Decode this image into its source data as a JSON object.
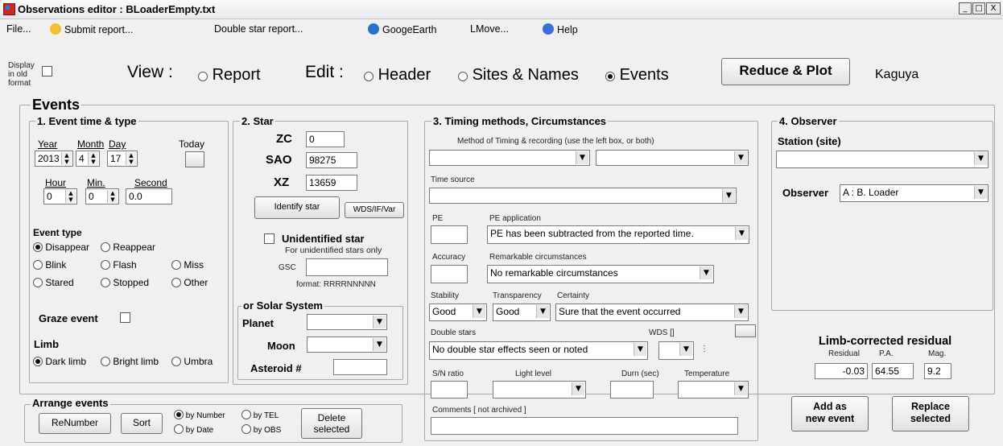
{
  "window": {
    "title": "Observations editor : BLoaderEmpty.txt",
    "btn_min": "_",
    "btn_max": "□",
    "btn_close": "X"
  },
  "menu": {
    "file": "File...",
    "submit": "Submit report...",
    "double": "Double star report...",
    "google": "GoogeEarth",
    "lmove": "LMove...",
    "help": "Help"
  },
  "top": {
    "display_old": "Display in old format",
    "view_label": "View :",
    "view_report": "Report",
    "edit_label": "Edit :",
    "edit_header": "Header",
    "edit_sites": "Sites & Names",
    "edit_events": "Events",
    "reduce": "Reduce & Plot",
    "kaguya": "Kaguya"
  },
  "events": {
    "title": "Events"
  },
  "sec1": {
    "title": "1.  Event time & type",
    "year_label": "Year",
    "month_label": "Month",
    "day_label": "Day",
    "today_label": "Today",
    "year": "2013",
    "month": "4",
    "day": "17",
    "hour_label": "Hour",
    "min_label": "Min.",
    "second_label": "Second",
    "hour": "0",
    "min": "0",
    "second": "0.0",
    "event_type": "Event type",
    "disappear": "Disappear",
    "reappear": "Reappear",
    "blink": "Blink",
    "flash": "Flash",
    "miss": "Miss",
    "started": "Stared",
    "stopped": "Stopped",
    "other": "Other",
    "graze": "Graze event",
    "limb": "Limb",
    "dark": "Dark limb",
    "bright": "Bright limb",
    "umbra": "Umbra"
  },
  "sec2": {
    "title": "2.  Star",
    "zc_label": "ZC",
    "zc": "0",
    "sao_label": "SAO",
    "sao": "98275",
    "xz_label": "XZ",
    "xz": "13659",
    "identify": "Identify star",
    "wds": "WDS/IF/Var",
    "unident": "Unidentified star",
    "unident_note": "For unidentified stars only",
    "gsc_label": "GSC",
    "gsc": "",
    "format": "format: RRRRNNNNN",
    "solar_title": "or  Solar System",
    "planet_label": "Planet",
    "moon_label": "Moon",
    "asteroid_label": "Asteroid #",
    "asteroid": ""
  },
  "sec3": {
    "title": "3.  Timing methods, Circumstances",
    "method_label": "Method of Timing & recording (use the left box, or both)",
    "time_source": "Time source",
    "pe_label": "PE",
    "pe_app_label": "PE application",
    "pe_app": "PE has been subtracted from the reported time.",
    "pe": "",
    "accuracy": "Accuracy",
    "remarkable_label": "Remarkable circumstances",
    "remarkable": "No remarkable circumstances",
    "stability_label": "Stability",
    "stability": "Good",
    "transparency_label": "Transparency",
    "transparency": "Good",
    "certainty_label": "Certainty",
    "certainty": "Sure that the event occurred",
    "double_label": "Double stars",
    "wds_label": "WDS []",
    "double": "No double star effects seen or noted",
    "dots": "⋮",
    "sn_label": "S/N ratio",
    "light_label": "Light level",
    "dur_label": "Durn (sec)",
    "temp_label": "Temperature",
    "comments_label": "Comments  [ not archived ]"
  },
  "sec4": {
    "title": "4.  Observer",
    "station_label": "Station (site)",
    "observer_label": "Observer",
    "observer": "A : B. Loader"
  },
  "residual": {
    "title": "Limb-corrected residual",
    "res_label": "Residual",
    "pa_label": "P.A.",
    "mag_label": "Mag.",
    "res": "-0.03",
    "pa": "64.55",
    "mag": "9.2"
  },
  "actions": {
    "add": "Add as\nnew event",
    "replace": "Replace\nselected"
  },
  "arrange": {
    "title": "Arrange events",
    "renumber": "ReNumber",
    "sort": "Sort",
    "by_number": "by Number",
    "by_tel": "by TEL",
    "by_date": "by Date",
    "by_obs": "by OBS",
    "delete": "Delete\nselected"
  },
  "colors": {
    "accent_icon": "#cc2a1e",
    "help_icon": "#3a6fd8"
  }
}
